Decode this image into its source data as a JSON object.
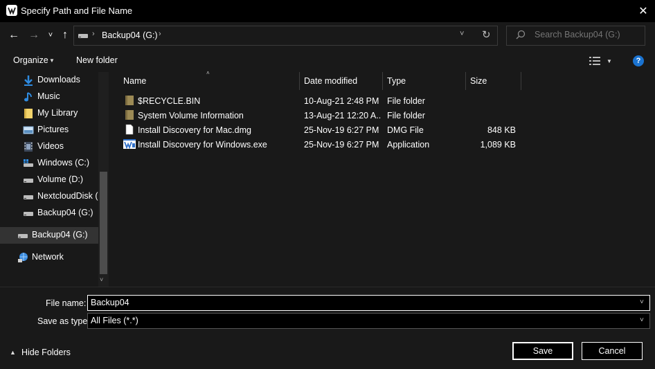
{
  "window": {
    "title": "Specify Path and File Name",
    "close_icon": "close-icon",
    "close_glyph": "✕"
  },
  "nav": {
    "back_glyph": "←",
    "forward_glyph": "→",
    "recent_glyph": "˅",
    "up_glyph": "↑",
    "address": {
      "location": "Backup04 (G:)",
      "sep": "›",
      "dropdown_glyph": "˅",
      "refresh_glyph": "↻"
    },
    "search": {
      "placeholder": "Search Backup04 (G:)"
    }
  },
  "toolbar": {
    "organize": "Organize",
    "caret": "▼",
    "new_folder": "New folder",
    "help_glyph": "?"
  },
  "sidebar": {
    "items": [
      {
        "label": "Downloads",
        "icon": "download-arrow-icon"
      },
      {
        "label": "Music",
        "icon": "music-note-icon"
      },
      {
        "label": "My Library",
        "icon": "folder-icon"
      },
      {
        "label": "Pictures",
        "icon": "pictures-icon"
      },
      {
        "label": "Videos",
        "icon": "video-icon"
      },
      {
        "label": "Windows (C:)",
        "icon": "windows-drive-icon"
      },
      {
        "label": "Volume (D:)",
        "icon": "drive-icon"
      },
      {
        "label": "NextcloudDisk (I",
        "icon": "drive-icon"
      },
      {
        "label": "Backup04 (G:)",
        "icon": "drive-icon"
      },
      {
        "label": "Backup04 (G:)",
        "icon": "drive-icon",
        "selected": true
      },
      {
        "label": "Network",
        "icon": "network-icon"
      }
    ],
    "scroll_down_glyph": "˅"
  },
  "files": {
    "columns": [
      "Name",
      "Date modified",
      "Type",
      "Size"
    ],
    "sort_glyph": "˄",
    "rows": [
      {
        "name": "$RECYCLE.BIN",
        "date": "10-Aug-21 2:48 PM",
        "type": "File folder",
        "size": "",
        "icon": "folder-icon"
      },
      {
        "name": "System Volume Information",
        "date": "13-Aug-21 12:20 A...",
        "type": "File folder",
        "size": "",
        "icon": "folder-icon"
      },
      {
        "name": "Install Discovery for Mac.dmg",
        "date": "25-Nov-19 6:27 PM",
        "type": "DMG File",
        "size": "848 KB",
        "icon": "file-icon"
      },
      {
        "name": "Install Discovery for Windows.exe",
        "date": "25-Nov-19 6:27 PM",
        "type": "Application",
        "size": "1,089 KB",
        "icon": "app-icon"
      }
    ]
  },
  "bottom": {
    "file_name_label": "File name:",
    "file_name_value": "Backup04",
    "save_type_label": "Save as type:",
    "save_type_value": "All Files (*.*)",
    "dropdown_glyph": "˅",
    "hide_folders": "Hide Folders",
    "hide_caret": "▲",
    "save": "Save",
    "cancel": "Cancel"
  },
  "colors": {
    "background": "#191919",
    "titlebar": "#000000",
    "selected": "#333333",
    "accent": "#1a73d1"
  }
}
